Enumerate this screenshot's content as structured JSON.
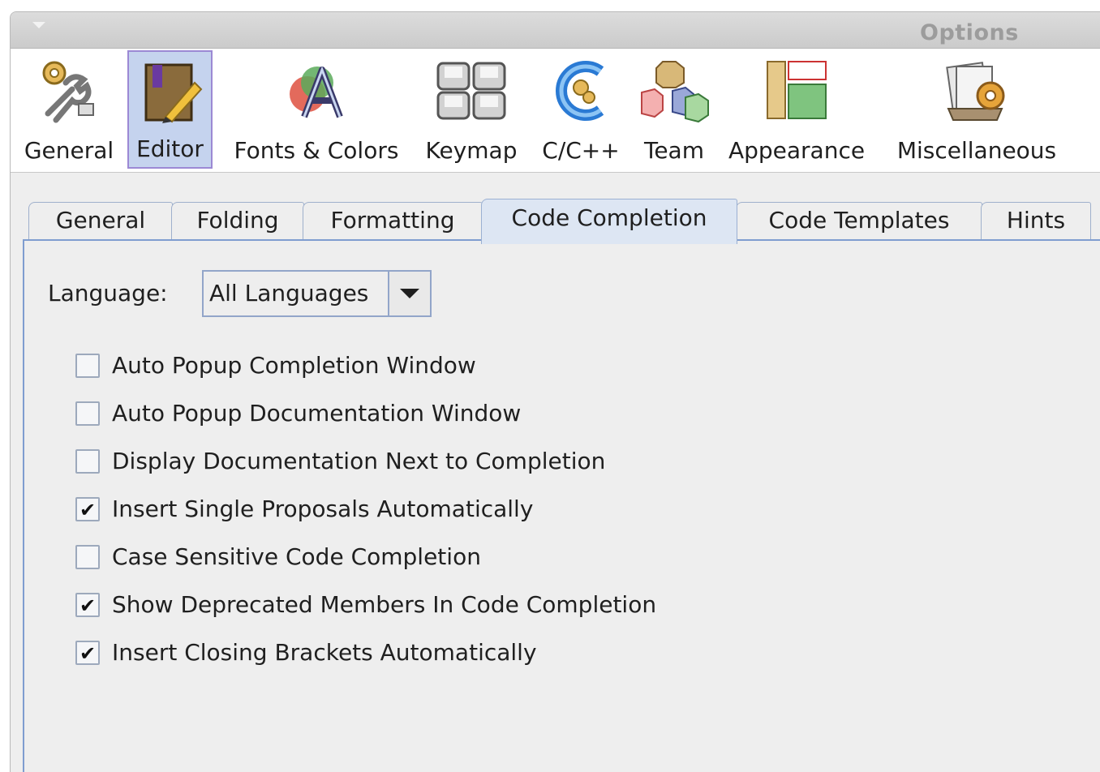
{
  "window": {
    "title": "Options"
  },
  "categories": [
    {
      "label": "General",
      "icon": "wrench-gear-icon"
    },
    {
      "label": "Editor",
      "icon": "editor-book-pencil-icon",
      "selected": true
    },
    {
      "label": "Fonts & Colors",
      "icon": "fonts-colors-icon"
    },
    {
      "label": "Keymap",
      "icon": "keyboard-keys-icon"
    },
    {
      "label": "C/C++",
      "icon": "cpp-icon"
    },
    {
      "label": "Team",
      "icon": "team-blocks-icon"
    },
    {
      "label": "Appearance",
      "icon": "appearance-layout-icon"
    },
    {
      "label": "Miscellaneous",
      "icon": "miscellaneous-icon"
    }
  ],
  "tabs": [
    {
      "label": "General",
      "active": false
    },
    {
      "label": "Folding",
      "active": false
    },
    {
      "label": "Formatting",
      "active": false
    },
    {
      "label": "Code Completion",
      "active": true
    },
    {
      "label": "Code Templates",
      "active": false
    },
    {
      "label": "Hints",
      "active": false
    }
  ],
  "language": {
    "label": "Language:",
    "value": "All Languages"
  },
  "options": [
    {
      "label": "Auto Popup Completion Window",
      "checked": false
    },
    {
      "label": "Auto Popup Documentation Window",
      "checked": false
    },
    {
      "label": "Display Documentation Next to Completion",
      "checked": false
    },
    {
      "label": "Insert Single Proposals Automatically",
      "checked": true
    },
    {
      "label": "Case Sensitive Code Completion",
      "checked": false
    },
    {
      "label": "Show Deprecated Members In Code Completion",
      "checked": true
    },
    {
      "label": "Insert Closing Brackets Automatically",
      "checked": true
    }
  ],
  "check_glyph": "✔"
}
